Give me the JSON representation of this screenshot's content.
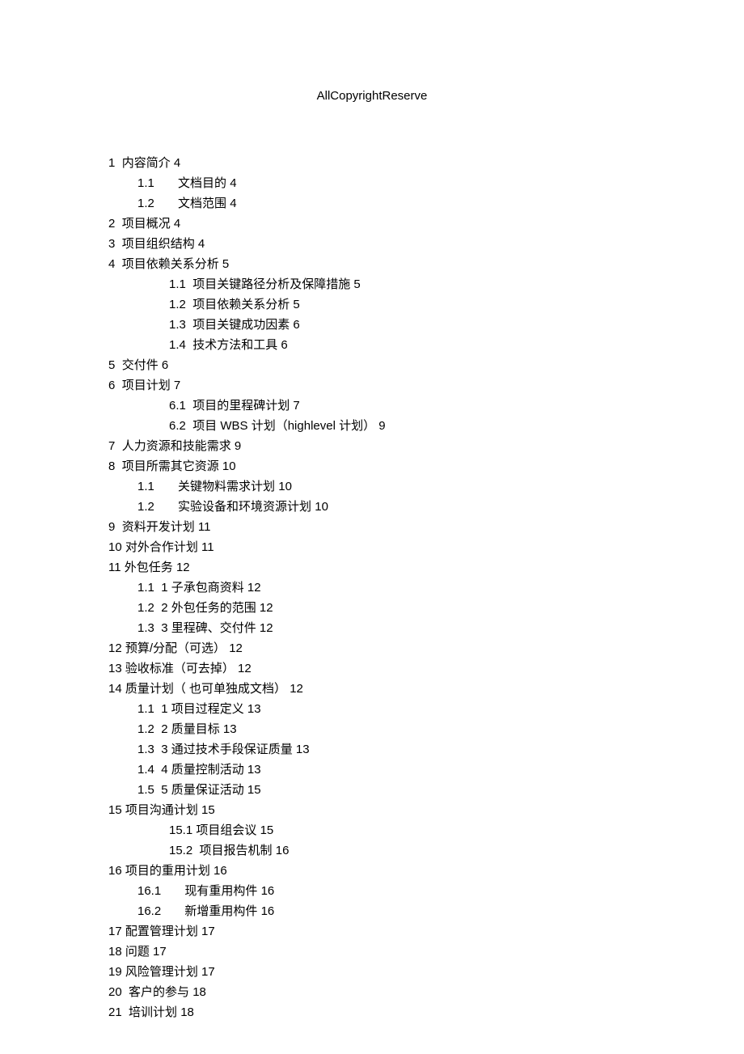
{
  "title": "AllCopyrightReserve",
  "toc": [
    {
      "cls": "l1",
      "num": "1",
      "gap": "  ",
      "txt": "内容简介",
      "pg": "4"
    },
    {
      "cls": "l2a",
      "num": "1.1",
      "gap": "       ",
      "txt": "文档目的",
      "pg": "4"
    },
    {
      "cls": "l2a",
      "num": "1.2",
      "gap": "       ",
      "txt": "文档范围",
      "pg": "4"
    },
    {
      "cls": "l1",
      "num": "2",
      "gap": "  ",
      "txt": "项目概况",
      "pg": "4"
    },
    {
      "cls": "l1",
      "num": "3",
      "gap": "  ",
      "txt": "项目组织结构",
      "pg": "4"
    },
    {
      "cls": "l1",
      "num": "4",
      "gap": "  ",
      "txt": "项目依赖关系分析",
      "pg": "5"
    },
    {
      "cls": "l2b",
      "num": "1.1",
      "gap": "  ",
      "txt": "项目关键路径分析及保障措施",
      "pg": "5"
    },
    {
      "cls": "l2b",
      "num": "1.2",
      "gap": "  ",
      "txt": "项目依赖关系分析",
      "pg": "5"
    },
    {
      "cls": "l2b",
      "num": "1.3",
      "gap": "  ",
      "txt": "项目关键成功因素",
      "pg": "6"
    },
    {
      "cls": "l2b",
      "num": "1.4",
      "gap": "  ",
      "txt": "技术方法和工具",
      "pg": "6"
    },
    {
      "cls": "l1",
      "num": "5",
      "gap": "  ",
      "txt": "交付件",
      "pg": "6"
    },
    {
      "cls": "l1",
      "num": "6",
      "gap": "  ",
      "txt": "项目计划",
      "pg": "7"
    },
    {
      "cls": "l2b",
      "num": "6.1",
      "gap": "  ",
      "txt": "项目的里程碑计划",
      "pg": "7"
    },
    {
      "cls": "l2b",
      "num": "6.2",
      "gap": "  ",
      "txt": "项目 WBS 计划（highlevel 计划）",
      "pg": "9"
    },
    {
      "cls": "l1",
      "num": "7",
      "gap": "  ",
      "txt": "人力资源和技能需求",
      "pg": "9"
    },
    {
      "cls": "l1",
      "num": "8",
      "gap": "  ",
      "txt": "项目所需其它资源",
      "pg": "10"
    },
    {
      "cls": "l2a",
      "num": "1.1",
      "gap": "       ",
      "txt": "关键物料需求计划",
      "pg": "10"
    },
    {
      "cls": "l2a",
      "num": "1.2",
      "gap": "       ",
      "txt": "实验设备和环境资源计划",
      "pg": "10"
    },
    {
      "cls": "l1",
      "num": "9",
      "gap": "  ",
      "txt": "资料开发计划",
      "pg": "11"
    },
    {
      "cls": "l1",
      "num": "10",
      "gap": " ",
      "txt": "对外合作计划",
      "pg": "11"
    },
    {
      "cls": "l1",
      "num": "11",
      "gap": " ",
      "txt": "外包任务",
      "pg": "12"
    },
    {
      "cls": "l2c",
      "num": "1.1",
      "gap": "  ",
      "txt": "1 子承包商资料",
      "pg": "12"
    },
    {
      "cls": "l2c",
      "num": "1.2",
      "gap": "  ",
      "txt": "2 外包任务的范围",
      "pg": "12"
    },
    {
      "cls": "l2c",
      "num": "1.3",
      "gap": "  ",
      "txt": "3 里程碑、交付件",
      "pg": "12"
    },
    {
      "cls": "l1",
      "num": "12",
      "gap": " ",
      "txt": "预算/分配（可选）",
      "pg": "12"
    },
    {
      "cls": "l1",
      "num": "13",
      "gap": " ",
      "txt": "验收标准（可去掉）",
      "pg": "12"
    },
    {
      "cls": "l1",
      "num": "14",
      "gap": " ",
      "txt": "质量计划（ 也可单独成文档）",
      "pg": "12"
    },
    {
      "cls": "l2c",
      "num": "1.1",
      "gap": "  ",
      "txt": "1 项目过程定义",
      "pg": "13"
    },
    {
      "cls": "l2c",
      "num": "1.2",
      "gap": "  ",
      "txt": "2 质量目标",
      "pg": "13"
    },
    {
      "cls": "l2c",
      "num": "1.3",
      "gap": "  ",
      "txt": "3 通过技术手段保证质量",
      "pg": "13"
    },
    {
      "cls": "l2c",
      "num": "1.4",
      "gap": "  ",
      "txt": "4 质量控制活动",
      "pg": "13"
    },
    {
      "cls": "l2c",
      "num": "1.5",
      "gap": "  ",
      "txt": "5 质量保证活动",
      "pg": "15"
    },
    {
      "cls": "l1",
      "num": "15",
      "gap": " ",
      "txt": "项目沟通计划",
      "pg": "15"
    },
    {
      "cls": "l2b",
      "num": "15.1",
      "gap": " ",
      "txt": "项目组会议",
      "pg": "15"
    },
    {
      "cls": "l2b",
      "num": "15.2",
      "gap": "  ",
      "txt": "项目报告机制",
      "pg": "16"
    },
    {
      "cls": "l1",
      "num": "16",
      "gap": " ",
      "txt": "项目的重用计划",
      "pg": "16"
    },
    {
      "cls": "l2a",
      "num": "16.1",
      "gap": "       ",
      "txt": "现有重用构件",
      "pg": "16"
    },
    {
      "cls": "l2a",
      "num": "16.2",
      "gap": "       ",
      "txt": "新增重用构件",
      "pg": "16"
    },
    {
      "cls": "l1",
      "num": "17",
      "gap": " ",
      "txt": "配置管理计划",
      "pg": "17"
    },
    {
      "cls": "l1",
      "num": "18",
      "gap": " ",
      "txt": "问题",
      "pg": "17"
    },
    {
      "cls": "l1",
      "num": "19",
      "gap": " ",
      "txt": "风险管理计划",
      "pg": "17"
    },
    {
      "cls": "l1",
      "num": "20",
      "gap": "  ",
      "txt": "客户的参与",
      "pg": "18"
    },
    {
      "cls": "l1",
      "num": "21",
      "gap": "  ",
      "txt": "培训计划",
      "pg": "18"
    }
  ]
}
